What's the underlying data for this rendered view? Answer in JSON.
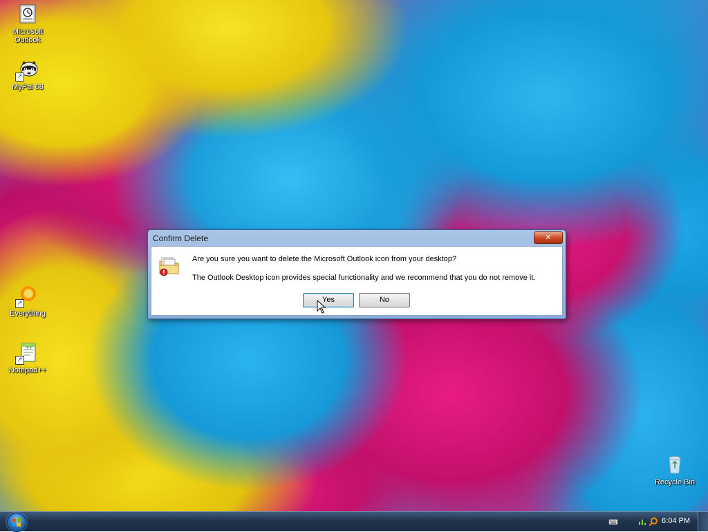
{
  "desktop": {
    "icons": [
      {
        "label": "Microsoft Outlook",
        "icon": "outlook-icon"
      },
      {
        "label": "MyPal 68",
        "icon": "mypal-raccoon-icon"
      },
      {
        "label": "Everything",
        "icon": "everything-search-icon"
      },
      {
        "label": "Notepad++",
        "icon": "notepadpp-icon"
      },
      {
        "label": "Recycle Bin",
        "icon": "recycle-bin-icon"
      }
    ]
  },
  "dialog": {
    "title": "Confirm Delete",
    "close_label": "✕",
    "message": "Are you sure you want to delete the Microsoft Outlook icon from your desktop?",
    "detail": "The Outlook Desktop icon provides special functionality and we recommend that you do not remove it.",
    "yes_label": "Yes",
    "no_label": "No"
  },
  "taskbar": {
    "start_icon": "windows-start-orb",
    "tray_icons": [
      "keyboard-icon",
      "network-icon",
      "search-icon"
    ],
    "clock": "6:04 PM"
  }
}
